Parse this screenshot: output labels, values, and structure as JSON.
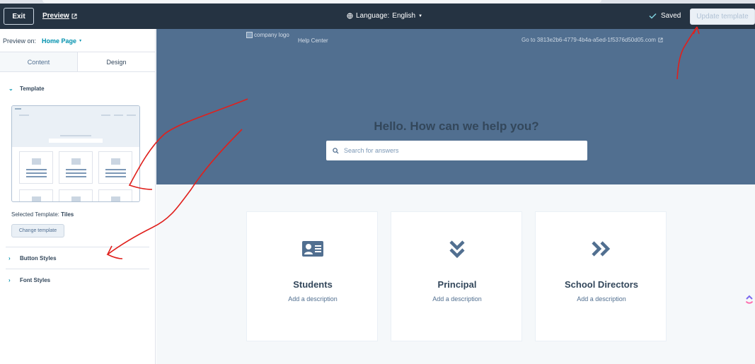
{
  "topbar": {
    "exit_label": "Exit",
    "preview_label": "Preview",
    "language_label": "Language:",
    "language_value": "English",
    "saved_label": "Saved",
    "update_label": "Update template"
  },
  "panel": {
    "preview_on_label": "Preview on:",
    "preview_on_value": "Home Page",
    "tabs": [
      {
        "label": "Content"
      },
      {
        "label": "Design"
      }
    ],
    "template_section": "Template",
    "selected_template_label": "Selected Template:",
    "selected_template_value": "Tiles",
    "change_template_label": "Change template",
    "button_styles_label": "Button Styles",
    "font_styles_label": "Font Styles"
  },
  "preview": {
    "logo_alt": "company logo",
    "help_center": "Help Center",
    "goto_link": "Go to 3813e2b6-4779-4b4a-a5ed-1f5376d50d05.com",
    "hero_title": "Hello. How can we help you?",
    "search_placeholder": "Search for answers",
    "categories": [
      {
        "name": "Students",
        "description": "Add a description",
        "icon": "id-card-icon"
      },
      {
        "name": "Principal",
        "description": "Add a description",
        "icon": "double-chevron-down-icon"
      },
      {
        "name": "School Directors",
        "description": "Add a description",
        "icon": "double-chevron-right-icon"
      }
    ]
  },
  "colors": {
    "topbar": "#253342",
    "hero": "#516f90",
    "accent": "#0091ae",
    "annotation": "#e0201c"
  }
}
